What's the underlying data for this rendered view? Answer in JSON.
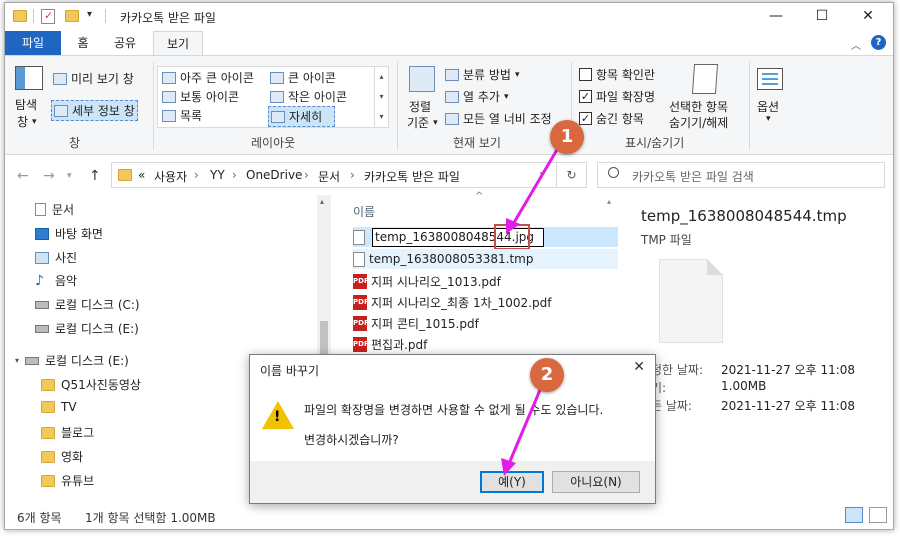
{
  "window": {
    "title": "카카오톡 받은 파일",
    "controls": {
      "minimize": "—",
      "maximize": "☐",
      "close": "✕"
    }
  },
  "ribbon_tabs": [
    "파일",
    "홈",
    "공유",
    "보기"
  ],
  "ribbon": {
    "pane_group": {
      "nav_pane_label": "탐색",
      "nav_pane_label2": "창",
      "preview_label": "미리 보기 창",
      "details_label": "세부 정보 창",
      "group_label": "창"
    },
    "layout_group": {
      "items": [
        "아주 큰 아이콘",
        "큰 아이콘",
        "보통 아이콘",
        "작은 아이콘",
        "목록",
        "자세히"
      ],
      "group_label": "레이아웃"
    },
    "current_view_group": {
      "sort_label": "정렬",
      "sort_label2": "기준",
      "group_by": "분류 방법",
      "add_columns": "열 추가",
      "fit_columns": "모든 열 너비 조정",
      "group_label": "현재 보기"
    },
    "show_hide_group": {
      "item_checkbox": "항목 확인란",
      "file_extensions": "파일 확장명",
      "hidden_items": "숨긴 항목",
      "hide_selected": "선택한 항목",
      "hide_selected2": "숨기기/해제",
      "group_label": "표시/숨기기"
    },
    "options_label": "옵션"
  },
  "address": {
    "crumbs": [
      "«",
      "사용자",
      "YY",
      "OneDrive",
      "문서",
      "카카오톡 받은 파일"
    ],
    "search_placeholder": "카카오톡 받은 파일 검색"
  },
  "nav_pane": {
    "items": [
      "문서",
      "바탕 화면",
      "사진",
      "음악",
      "로컬 디스크 (C:)",
      "로컬 디스크 (E:)"
    ],
    "drive": "로컬 디스크 (E:)",
    "folders": [
      "Q51사진동영상",
      "TV",
      "블로그",
      "영화",
      "유튜브"
    ]
  },
  "file_list": {
    "header": "이름",
    "rename_value": "temp_1638008048544.jpg",
    "files": [
      "temp_1638008053381.tmp",
      "지퍼 시나리오_1013.pdf",
      "지퍼 시나리오_최종 1차_1002.pdf",
      "지퍼 콘티_1015.pdf",
      "편집과.pdf"
    ],
    "pdf_badge": "PDF"
  },
  "preview": {
    "title": "temp_1638008048544.tmp",
    "type": "TMP 파일",
    "rows": [
      {
        "label": "정한 날짜:",
        "value": "2021-11-27 오후 11:08"
      },
      {
        "label": "기:",
        "value": "1.00MB"
      },
      {
        "label": "든 날짜:",
        "value": "2021-11-27 오후 11:08"
      }
    ]
  },
  "status_bar": {
    "count": "6개 항목",
    "selected": "1개 항목 선택함 1.00MB"
  },
  "dialog": {
    "title": "이름 바꾸기",
    "message1": "파일의 확장명을 변경하면 사용할 수 없게 될 수도 있습니다.",
    "message2": "변경하시겠습니까?",
    "yes": "예(Y)",
    "no": "아니요(N)"
  },
  "callouts": [
    "1",
    "2"
  ],
  "colors": {
    "accent": "#1e66c2",
    "callout": "#d9683f",
    "arrow": "#e21ce6",
    "highlight_box": "#c0504d"
  }
}
